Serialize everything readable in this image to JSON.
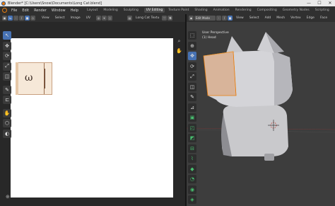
{
  "window": {
    "title": "Blender* [C:\\Users\\Snow\\Documents\\Long Cat.blend]",
    "min": "—",
    "max": "☐",
    "close": "✕"
  },
  "menubar": {
    "menus": [
      "File",
      "Edit",
      "Render",
      "Window",
      "Help"
    ],
    "workspaces": [
      "Layout",
      "Modeling",
      "Sculpting",
      "UV Editing",
      "Texture Paint",
      "Shading",
      "Animation",
      "Rendering",
      "Compositing",
      "Geometry Nodes",
      "Scripting"
    ],
    "active_workspace": "UV Editing"
  },
  "uv_header": {
    "menus": [
      "View",
      "Select",
      "Image",
      "UV"
    ],
    "image_name": "Long Cat Textu"
  },
  "view3d_header": {
    "mode": "Edit Mode",
    "menus": [
      "View",
      "Select",
      "Add",
      "Mesh",
      "Vertex",
      "Edge",
      "Face"
    ]
  },
  "viewport": {
    "perspective": "User Perspective",
    "object": "(1) Head"
  },
  "texture": {
    "face_text": "ω"
  },
  "colors": {
    "accent": "#4772b3",
    "selection_orange": "#e87d0d",
    "face_select": "#d4a080"
  },
  "icons": {
    "uv_tools": [
      "cursor-icon",
      "move-icon",
      "rotate-icon",
      "scale-icon",
      "transform-icon",
      "annotate-icon",
      "rip-icon",
      "grab-icon",
      "relax-icon",
      "pinch-icon"
    ],
    "view3d_tools": [
      "select-box-icon",
      "cursor-icon",
      "move-icon",
      "rotate-icon",
      "scale-icon",
      "transform-icon",
      "annotate-icon",
      "measure-icon",
      "extrude-icon",
      "inset-icon",
      "bevel-icon",
      "loopcut-icon",
      "knife-icon",
      "polybuild-icon",
      "spin-icon",
      "smooth-icon",
      "shrink-icon",
      "shear-icon",
      "rip-icon"
    ]
  }
}
